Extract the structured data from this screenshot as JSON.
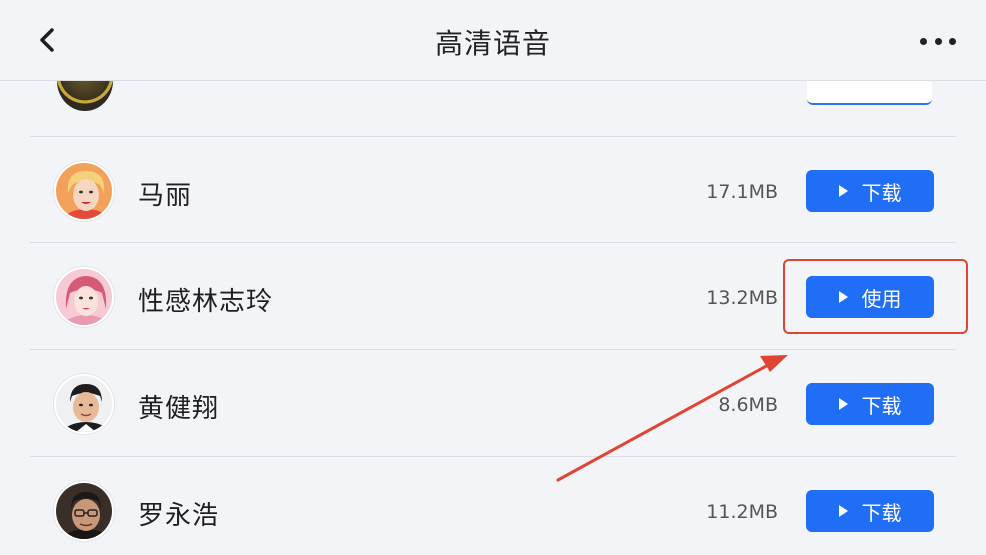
{
  "header": {
    "title": "高清语音",
    "back_icon": "chevron-left-icon",
    "more_icon": "more-horizontal-icon"
  },
  "voices": [
    {
      "name": "马丽",
      "size": "17.1MB",
      "action": "下载",
      "avatar": "avatar-mali"
    },
    {
      "name": "性感林志玲",
      "size": "13.2MB",
      "action": "使用",
      "avatar": "avatar-linzhiling"
    },
    {
      "name": "黄健翔",
      "size": "8.6MB",
      "action": "下载",
      "avatar": "avatar-huangjianxiang"
    },
    {
      "name": "罗永浩",
      "size": "11.2MB",
      "action": "下载",
      "avatar": "avatar-luoyonghao"
    }
  ],
  "colors": {
    "background": "#f3f4f8",
    "button": "#1f6ef5",
    "annotation": "#e04433"
  }
}
